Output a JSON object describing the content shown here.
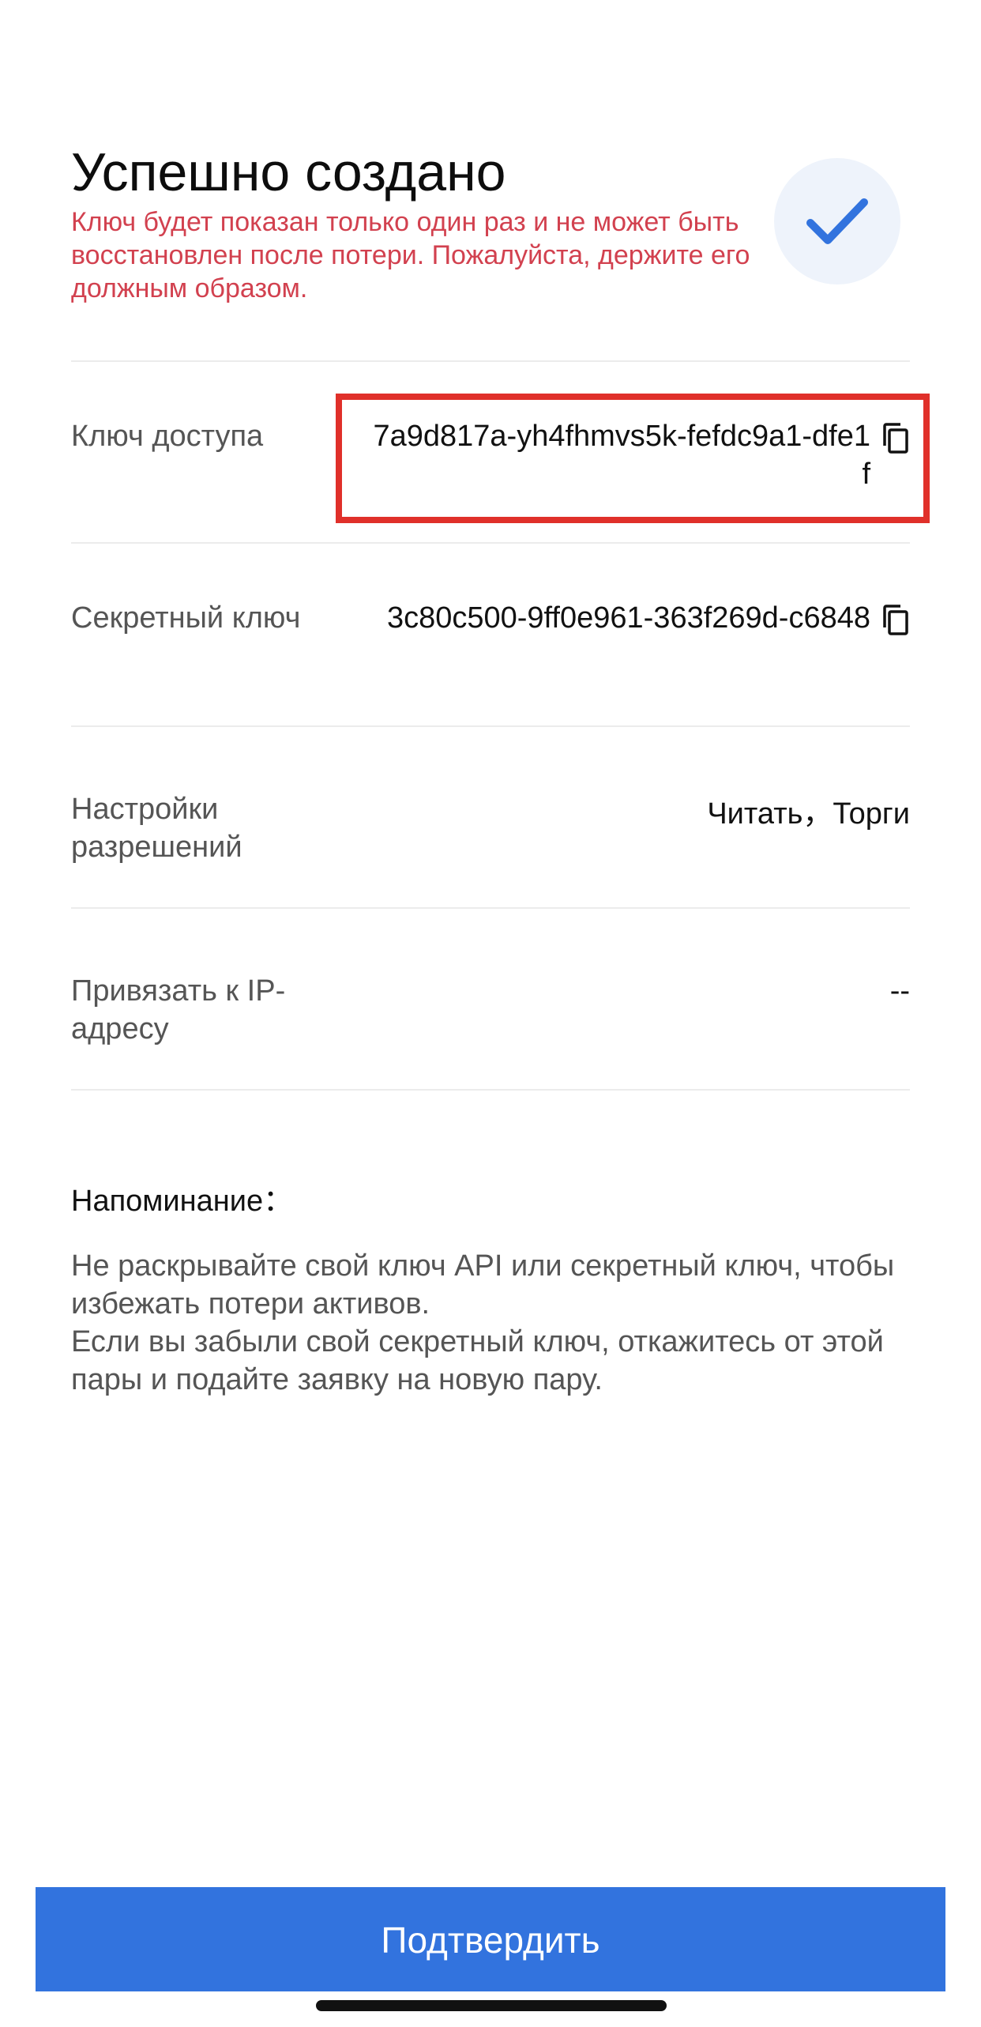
{
  "header": {
    "title": "Успешно создано",
    "warning": "Ключ будет показан только один раз и не может быть восстановлен после потери. Пожалуйста, держите его должным образом."
  },
  "rows": {
    "access_key": {
      "label": "Ключ доступа",
      "value": "7a9d817a-yh4fhmvs5k-fefdc9a1-dfe1f"
    },
    "secret_key": {
      "label": "Секретный ключ",
      "value": "3c80c500-9ff0e961-363f269d-c6848"
    },
    "permissions": {
      "label": "Настройки разрешений",
      "value": "Читать，Торги"
    },
    "ip_binding": {
      "label": "Привязать к IP-адресу",
      "value": "--"
    }
  },
  "reminder": {
    "title": "Напоминание：",
    "lines": [
      "Не раскрывайте свой ключ API или секретный ключ, чтобы избежать потери активов.",
      "Если вы забыли свой секретный ключ, откажитесь от этой пары и подайте заявку на новую пару."
    ]
  },
  "footer": {
    "confirm_label": "Подтвердить"
  },
  "colors": {
    "accent": "#3273de",
    "warning": "#d2414f",
    "highlight": "#e0302a"
  },
  "icons": {
    "success": "checkmark-icon",
    "copy": "copy-icon"
  }
}
